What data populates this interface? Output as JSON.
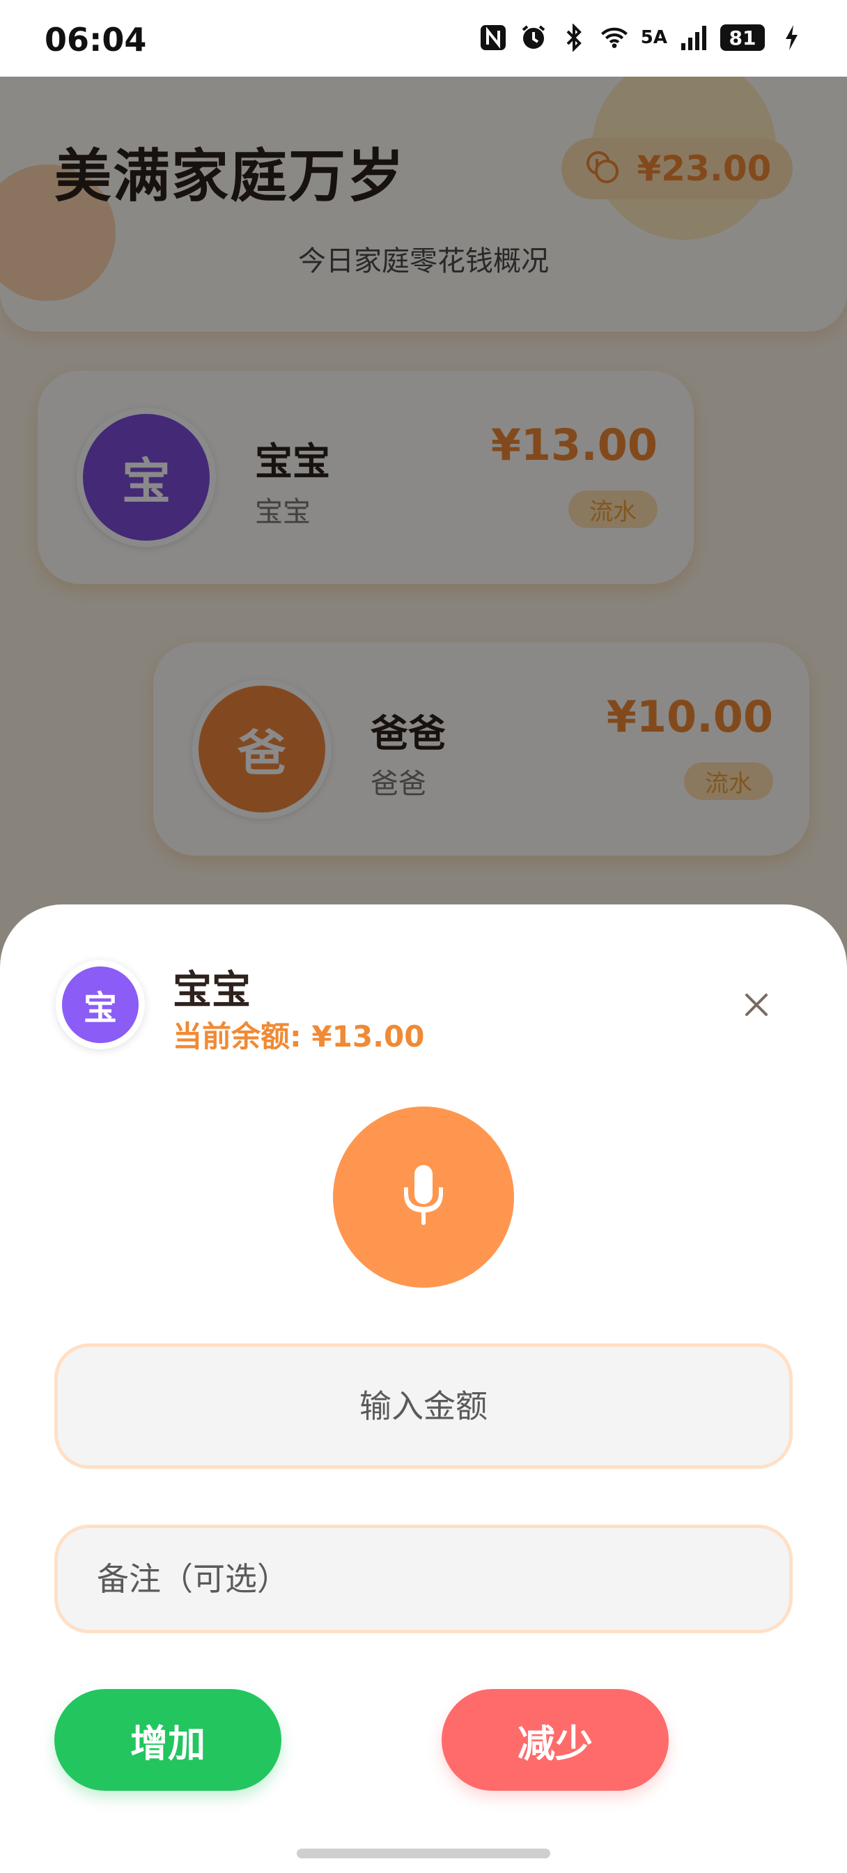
{
  "status_bar": {
    "time": "06:04",
    "network": "5A",
    "battery": "81",
    "icons": [
      "nfc-icon",
      "alarm-icon",
      "bluetooth-icon",
      "wifi-icon",
      "signal-icon",
      "battery-icon",
      "charging-icon"
    ]
  },
  "header": {
    "title": "美满家庭万岁",
    "total": "¥23.00",
    "subtitle": "今日家庭零花钱概况",
    "total_icon": "coins-icon"
  },
  "members": [
    {
      "avatar": "宝",
      "name": "宝宝",
      "role": "宝宝",
      "amount": "¥13.00",
      "badge": "流水",
      "color": "#7c4ddb"
    },
    {
      "avatar": "爸",
      "name": "爸爸",
      "role": "爸爸",
      "amount": "¥10.00",
      "badge": "流水",
      "color": "#f0883c"
    }
  ],
  "sheet": {
    "avatar": "宝",
    "name": "宝宝",
    "balance": "当前余额: ¥13.00",
    "amount_placeholder": "输入金额",
    "note_placeholder": "备注（可选）",
    "add_label": "增加",
    "subtract_label": "减少",
    "mic_icon": "microphone-icon",
    "close_icon": "close-icon"
  },
  "colors": {
    "accent": "#f08a34",
    "add": "#22c55e",
    "subtract": "#ff6b6b",
    "mic": "#ff9650",
    "sheet_avatar": "#8b5cf6"
  }
}
